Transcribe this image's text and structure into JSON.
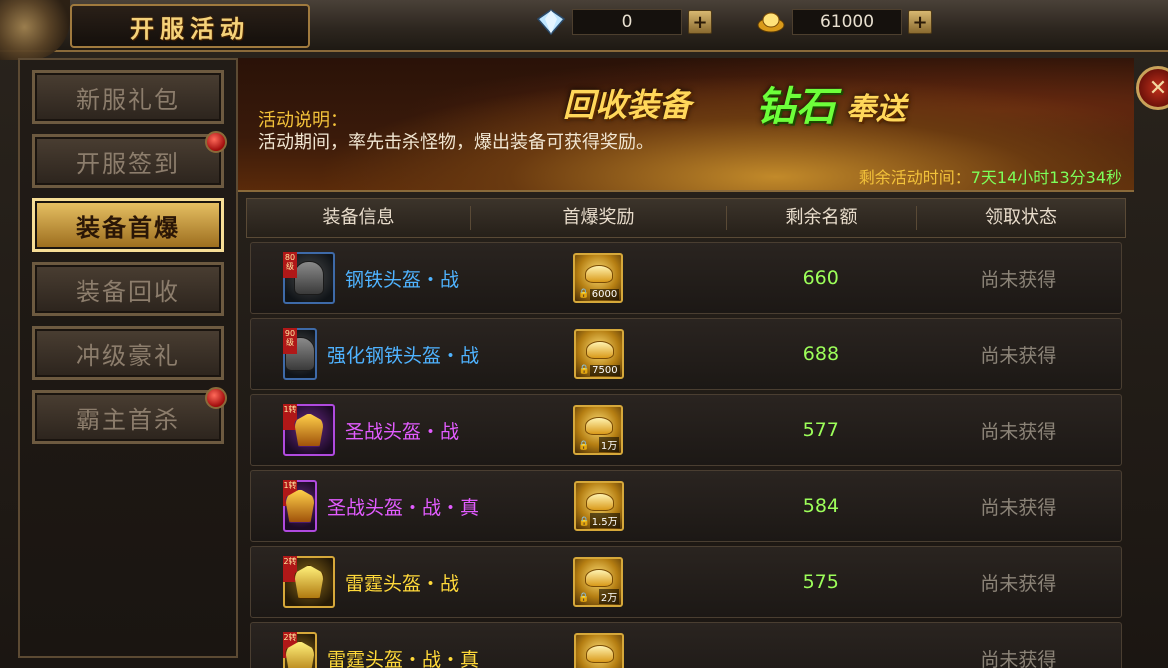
{
  "title": "开服活动",
  "currency": {
    "diamond": {
      "icon": "diamond-icon",
      "value": "0"
    },
    "gold": {
      "icon": "gold-ingot-icon",
      "value": "61000"
    }
  },
  "menu": [
    {
      "label": "新服礼包",
      "active": false,
      "badge": false
    },
    {
      "label": "开服签到",
      "active": false,
      "badge": true
    },
    {
      "label": "装备首爆",
      "active": true,
      "badge": false
    },
    {
      "label": "装备回收",
      "active": false,
      "badge": false
    },
    {
      "label": "冲级豪礼",
      "active": false,
      "badge": false
    },
    {
      "label": "霸主首杀",
      "active": false,
      "badge": true
    }
  ],
  "banner": {
    "title_a": "回收装备",
    "title_b": "钻石",
    "title_c": "奉送",
    "desc_label": "活动说明：",
    "desc_text": "活动期间，率先击杀怪物，爆出装备可获得奖励。",
    "timer_label": "剩余活动时间：",
    "timer_value": "7天14小时13分34秒"
  },
  "table": {
    "headers": [
      "装备信息",
      "首爆奖励",
      "剩余名额",
      "领取状态"
    ],
    "rows": [
      {
        "level_tag": "80级",
        "name": "钢铁头盔・战",
        "quality": "blue",
        "reward": "6000",
        "quota": "660",
        "status": "尚未获得"
      },
      {
        "level_tag": "90级",
        "name": "强化钢铁头盔・战",
        "quality": "blue",
        "reward": "7500",
        "quota": "688",
        "status": "尚未获得"
      },
      {
        "level_tag": "1转",
        "name": "圣战头盔・战",
        "quality": "purple",
        "reward": "1万",
        "quota": "577",
        "status": "尚未获得"
      },
      {
        "level_tag": "1转",
        "name": "圣战头盔・战・真",
        "quality": "purple",
        "reward": "1.5万",
        "quota": "584",
        "status": "尚未获得"
      },
      {
        "level_tag": "2转",
        "name": "雷霆头盔・战",
        "quality": "gold",
        "reward": "2万",
        "quota": "575",
        "status": "尚未获得"
      },
      {
        "level_tag": "2转",
        "name": "雷霆头盔・战・真",
        "quality": "gold",
        "reward": "",
        "quota": "",
        "status": "尚未获得"
      }
    ]
  },
  "colors": {
    "accent_gold": "#f3c23a",
    "quota_green": "#9dff5a",
    "timer_green": "#7dff5a",
    "blue_item": "#4fb3ff",
    "purple_item": "#e25cff",
    "gold_item": "#ffd93a"
  }
}
